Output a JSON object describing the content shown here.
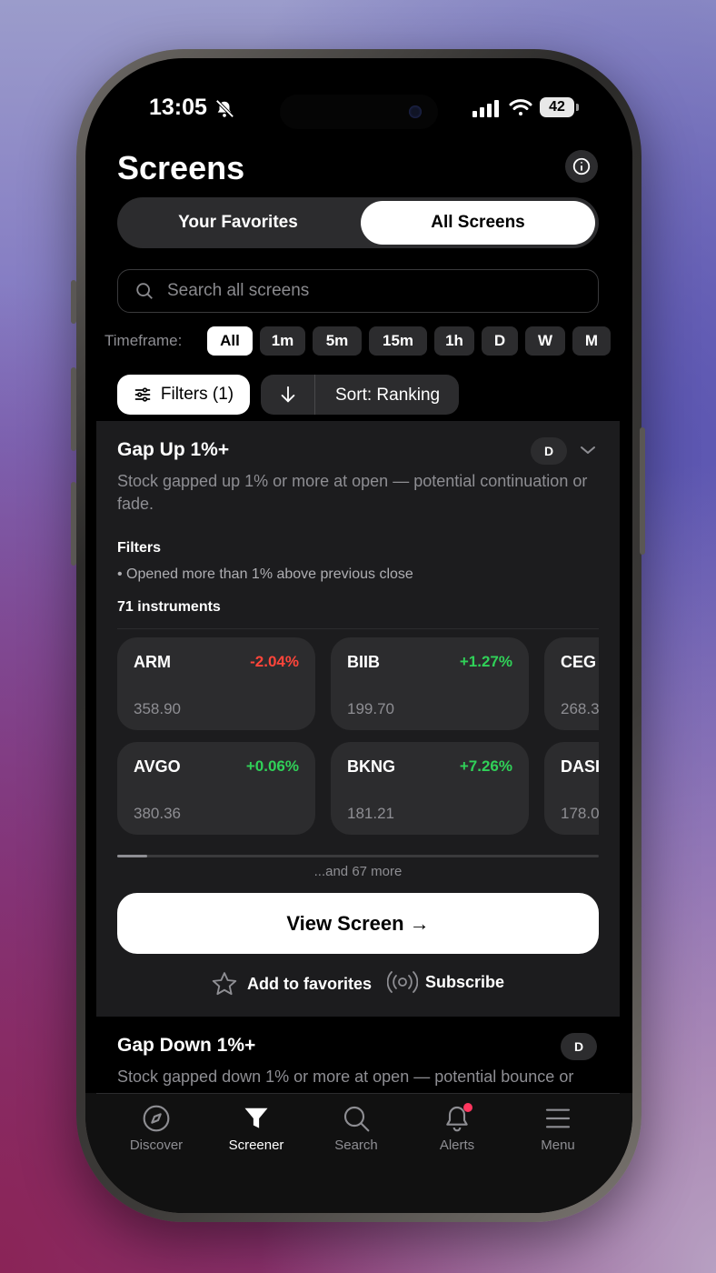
{
  "status_bar": {
    "time": "13:05",
    "battery": "42"
  },
  "header": {
    "title": "Screens"
  },
  "segments": [
    {
      "label": "Your Favorites",
      "active": false
    },
    {
      "label": "All Screens",
      "active": true
    }
  ],
  "search": {
    "placeholder": "Search all screens"
  },
  "timeframe": {
    "label": "Timeframe:",
    "options": [
      "All",
      "1m",
      "5m",
      "15m",
      "1h",
      "D",
      "W",
      "M"
    ],
    "selected": "All"
  },
  "controls": {
    "filters_label": "Filters (1)",
    "sort_label": "Sort: Ranking"
  },
  "screen_card": {
    "title": "Gap Up 1%+",
    "badge": "D",
    "description": "Stock gapped up 1% or more at open — potential continuation or fade.",
    "filters_heading": "Filters",
    "filters": [
      "• Opened more than 1% above previous close"
    ],
    "instrument_count": "71 instruments",
    "instruments": [
      {
        "symbol": "ARM",
        "change": "-2.04%",
        "price": "358.90",
        "direction": "down"
      },
      {
        "symbol": "BIIB",
        "change": "+1.27%",
        "price": "199.70",
        "direction": "up"
      },
      {
        "symbol": "CEG",
        "change": "",
        "price": "268.3",
        "direction": "up"
      },
      {
        "symbol": "AVGO",
        "change": "+0.06%",
        "price": "380.36",
        "direction": "up"
      },
      {
        "symbol": "BKNG",
        "change": "+7.26%",
        "price": "181.21",
        "direction": "up"
      },
      {
        "symbol": "DASI",
        "change": "",
        "price": "178.0",
        "direction": "up"
      }
    ],
    "more_text": "...and 67 more",
    "view_button": "View Screen →",
    "favorite_label": "Add to favorites",
    "subscribe_label": "Subscribe"
  },
  "next_card": {
    "title": "Gap Down 1%+",
    "badge": "D",
    "description": "Stock gapped down 1% or more at open — potential bounce or"
  },
  "tabbar": [
    {
      "label": "Discover",
      "icon": "compass-icon",
      "active": false
    },
    {
      "label": "Screener",
      "icon": "funnel-icon",
      "active": true
    },
    {
      "label": "Search",
      "icon": "search-icon",
      "active": false
    },
    {
      "label": "Alerts",
      "icon": "bell-icon",
      "active": false,
      "has_dot": true
    },
    {
      "label": "Menu",
      "icon": "menu-icon",
      "active": false
    }
  ],
  "colors": {
    "positive": "#30d158",
    "negative": "#ff453a",
    "accent_dot": "#ff375f"
  }
}
